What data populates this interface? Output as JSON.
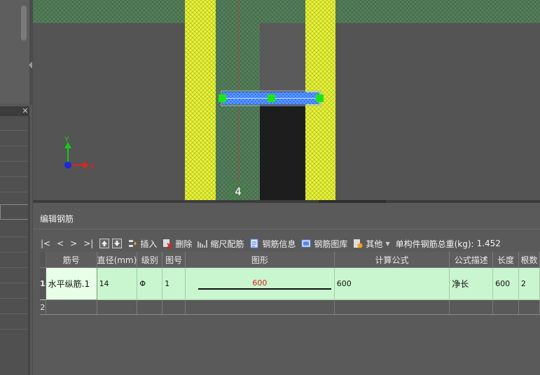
{
  "canvas": {
    "axis_x_label": "X",
    "axis_y_label": "Y",
    "axis_marker": "4"
  },
  "panel": {
    "title": "编辑钢筋"
  },
  "toolbar": {
    "nav_first": "|<",
    "nav_prev": "<",
    "nav_next": ">",
    "nav_last": ">|",
    "insert": "插入",
    "delete": "删除",
    "scale_rebar": "缩尺配筋",
    "rebar_info": "钢筋信息",
    "rebar_library": "钢筋图库",
    "other": "其他",
    "total_weight_label": "单构件钢筋总重(kg):",
    "total_weight_value": "1.452"
  },
  "table": {
    "headers": [
      "筋号",
      "直径(mm)",
      "级别",
      "图号",
      "图形",
      "计算公式",
      "公式描述",
      "长度",
      "根数"
    ],
    "rows": [
      {
        "index": "1",
        "bar_no": "水平纵筋.1",
        "diameter": "14",
        "grade": "Φ",
        "shape_no": "1",
        "shape_value": "600",
        "formula": "600",
        "formula_desc": "净长",
        "length": "600",
        "count": "2"
      },
      {
        "index": "2"
      }
    ]
  },
  "colors": {
    "rebar_row": "#c9f5cf",
    "wall_yellow": "#e8f53a",
    "beam_blue": "#2a73ff",
    "grip_green": "#19e619"
  }
}
